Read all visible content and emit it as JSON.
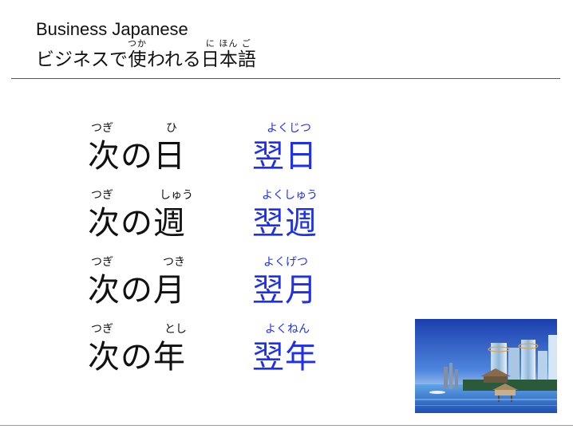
{
  "header": {
    "title_en": "Business Japanese",
    "title_jp_pre": "ビジネスで",
    "title_jp_tsuka_rb": "使",
    "title_jp_tsuka_rt": "つか",
    "title_jp_mid": "われる",
    "title_jp_nihongo_rb": "日本語",
    "title_jp_nihongo_rt": "に ほん ご"
  },
  "rows": [
    {
      "word": "次の日",
      "word_ruby_1": "つぎ",
      "word_ruby_2": "ひ",
      "alt": "翌日",
      "alt_ruby": "よくじつ"
    },
    {
      "word": "次の週",
      "word_ruby_1": "つぎ",
      "word_ruby_2": "しゅう",
      "alt": "翌週",
      "alt_ruby": "よくしゅう"
    },
    {
      "word": "次の月",
      "word_ruby_1": "つぎ",
      "word_ruby_2": "つき",
      "alt": "翌月",
      "alt_ruby": "よくげつ"
    },
    {
      "word": "次の年",
      "word_ruby_1": "つぎ",
      "word_ruby_2": "とし",
      "alt": "翌年",
      "alt_ruby": "よくねん"
    }
  ],
  "colors": {
    "accent_blue": "#1d2ff0",
    "text": "#111111"
  },
  "image": {
    "icon": "city-waterfront-photo"
  }
}
